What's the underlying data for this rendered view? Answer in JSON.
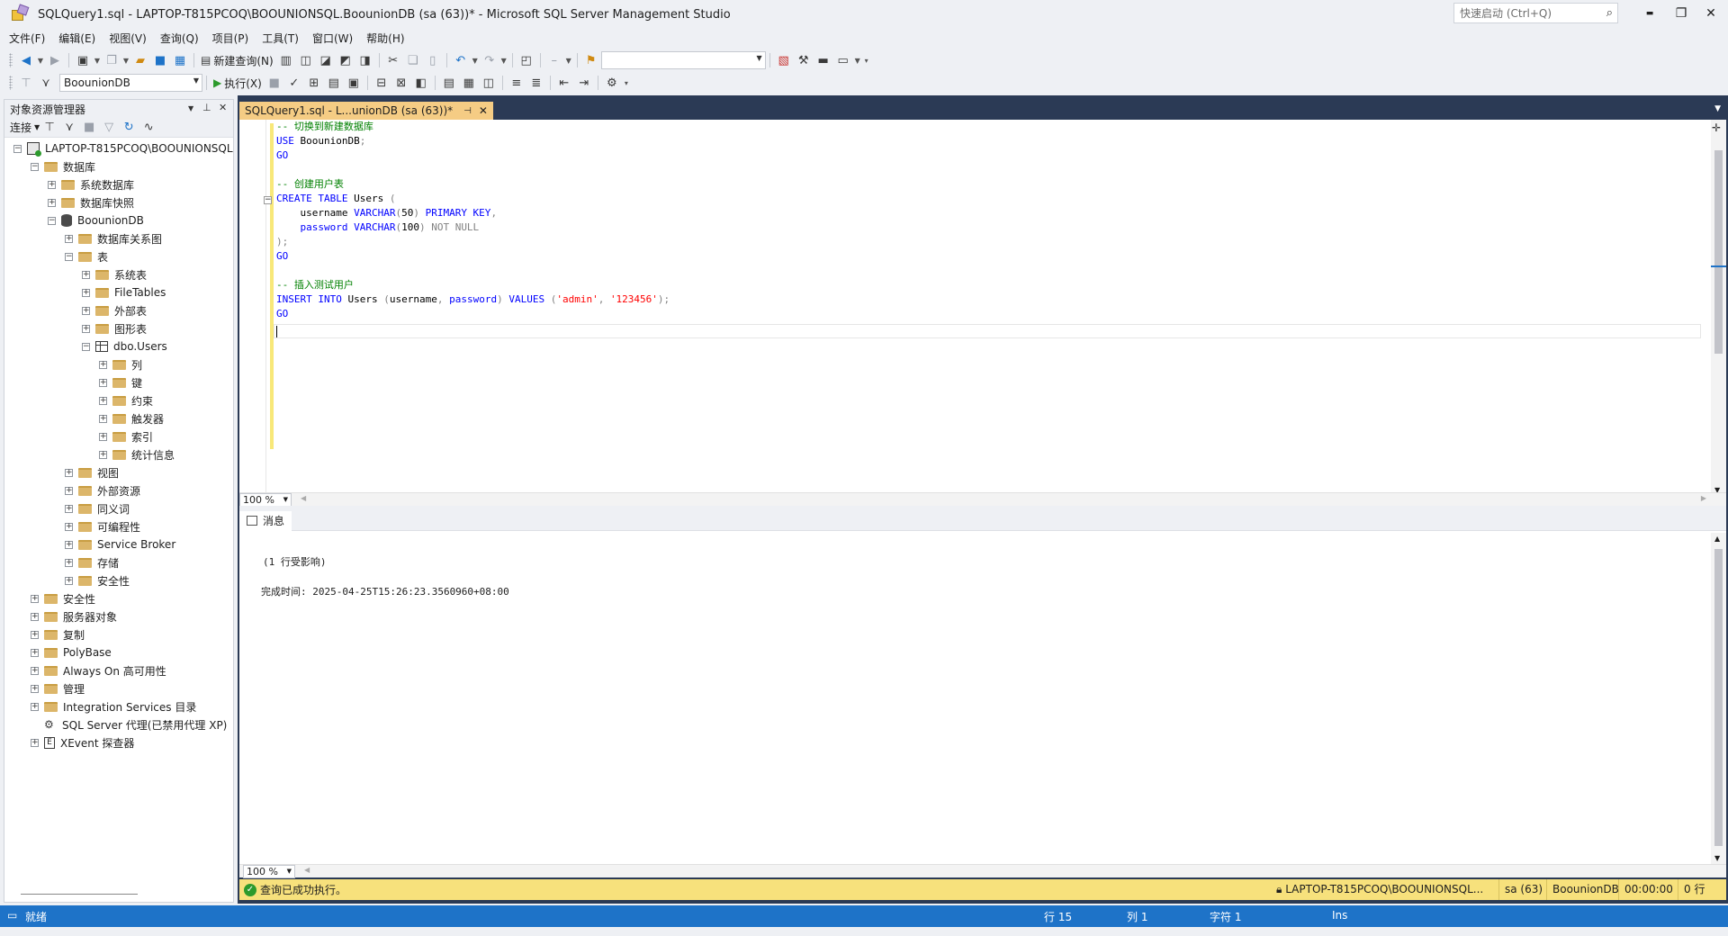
{
  "window": {
    "title": "SQLQuery1.sql - LAPTOP-T815PCOQ\\BOOUNIONSQL.BoounionDB (sa (63))* - Microsoft SQL Server Management Studio",
    "quick_launch_placeholder": "快速启动 (Ctrl+Q)",
    "minimize": "▬",
    "restore": "❐",
    "close": "✕"
  },
  "menu": [
    "文件(F)",
    "编辑(E)",
    "视图(V)",
    "查询(Q)",
    "项目(P)",
    "工具(T)",
    "窗口(W)",
    "帮助(H)"
  ],
  "toolbar": {
    "new_query_label": "新建查询(N)",
    "database_selector_value": "BoounionDB",
    "execute_label": "执行(X)",
    "solution_config_value": ""
  },
  "object_explorer": {
    "title": "对象资源管理器",
    "connect_label": "连接",
    "tree": [
      {
        "label": "LAPTOP-T815PCOQ\\BOOUNIONSQL",
        "level": 0,
        "expanded": true,
        "icon": "server"
      },
      {
        "label": "数据库",
        "level": 1,
        "expanded": true,
        "icon": "folder"
      },
      {
        "label": "系统数据库",
        "level": 2,
        "expanded": false,
        "icon": "folder"
      },
      {
        "label": "数据库快照",
        "level": 2,
        "expanded": false,
        "icon": "folder"
      },
      {
        "label": "BoounionDB",
        "level": 2,
        "expanded": true,
        "icon": "database"
      },
      {
        "label": "数据库关系图",
        "level": 3,
        "expanded": false,
        "icon": "folder"
      },
      {
        "label": "表",
        "level": 3,
        "expanded": true,
        "icon": "folder"
      },
      {
        "label": "系统表",
        "level": 4,
        "expanded": false,
        "icon": "folder"
      },
      {
        "label": "FileTables",
        "level": 4,
        "expanded": false,
        "icon": "folder"
      },
      {
        "label": "外部表",
        "level": 4,
        "expanded": false,
        "icon": "folder"
      },
      {
        "label": "图形表",
        "level": 4,
        "expanded": false,
        "icon": "folder"
      },
      {
        "label": "dbo.Users",
        "level": 4,
        "expanded": true,
        "icon": "table"
      },
      {
        "label": "列",
        "level": 5,
        "expanded": false,
        "icon": "folder"
      },
      {
        "label": "键",
        "level": 5,
        "expanded": false,
        "icon": "folder"
      },
      {
        "label": "约束",
        "level": 5,
        "expanded": false,
        "icon": "folder"
      },
      {
        "label": "触发器",
        "level": 5,
        "expanded": false,
        "icon": "folder"
      },
      {
        "label": "索引",
        "level": 5,
        "expanded": false,
        "icon": "folder"
      },
      {
        "label": "统计信息",
        "level": 5,
        "expanded": false,
        "icon": "folder"
      },
      {
        "label": "视图",
        "level": 3,
        "expanded": false,
        "icon": "folder"
      },
      {
        "label": "外部资源",
        "level": 3,
        "expanded": false,
        "icon": "folder"
      },
      {
        "label": "同义词",
        "level": 3,
        "expanded": false,
        "icon": "folder"
      },
      {
        "label": "可编程性",
        "level": 3,
        "expanded": false,
        "icon": "folder"
      },
      {
        "label": "Service Broker",
        "level": 3,
        "expanded": false,
        "icon": "folder"
      },
      {
        "label": "存储",
        "level": 3,
        "expanded": false,
        "icon": "folder"
      },
      {
        "label": "安全性",
        "level": 3,
        "expanded": false,
        "icon": "folder"
      },
      {
        "label": "安全性",
        "level": 1,
        "expanded": false,
        "icon": "folder"
      },
      {
        "label": "服务器对象",
        "level": 1,
        "expanded": false,
        "icon": "folder"
      },
      {
        "label": "复制",
        "level": 1,
        "expanded": false,
        "icon": "folder"
      },
      {
        "label": "PolyBase",
        "level": 1,
        "expanded": false,
        "icon": "folder"
      },
      {
        "label": "Always On 高可用性",
        "level": 1,
        "expanded": false,
        "icon": "folder"
      },
      {
        "label": "管理",
        "level": 1,
        "expanded": false,
        "icon": "folder"
      },
      {
        "label": "Integration Services 目录",
        "level": 1,
        "expanded": false,
        "icon": "folder"
      },
      {
        "label": "SQL Server 代理(已禁用代理 XP)",
        "level": 1,
        "expanded": null,
        "icon": "agent"
      },
      {
        "label": "XEvent 探查器",
        "level": 1,
        "expanded": false,
        "icon": "xevent"
      }
    ]
  },
  "document_tab": {
    "label": "SQLQuery1.sql - L...unionDB (sa (63))*"
  },
  "editor": {
    "lines": [
      [
        {
          "t": "-- 切换到新建数据库",
          "c": "cm"
        }
      ],
      [
        {
          "t": "USE",
          "c": "kw"
        },
        {
          "t": " BoounionDB",
          "c": "tx"
        },
        {
          "t": ";",
          "c": "gr"
        }
      ],
      [
        {
          "t": "GO",
          "c": "kw"
        }
      ],
      [],
      [
        {
          "t": "-- 创建用户表",
          "c": "cm"
        }
      ],
      [
        {
          "t": "CREATE",
          "c": "kw"
        },
        {
          "t": " ",
          "c": "tx"
        },
        {
          "t": "TABLE",
          "c": "kw"
        },
        {
          "t": " Users ",
          "c": "tx"
        },
        {
          "t": "(",
          "c": "gr"
        }
      ],
      [
        {
          "t": "    username ",
          "c": "tx"
        },
        {
          "t": "VARCHAR",
          "c": "kw"
        },
        {
          "t": "(",
          "c": "gr"
        },
        {
          "t": "50",
          "c": "tx"
        },
        {
          "t": ")",
          "c": "gr"
        },
        {
          "t": " ",
          "c": "tx"
        },
        {
          "t": "PRIMARY KEY",
          "c": "kw"
        },
        {
          "t": ",",
          "c": "gr"
        }
      ],
      [
        {
          "t": "    password ",
          "c": "kw"
        },
        {
          "t": "VARCHAR",
          "c": "kw"
        },
        {
          "t": "(",
          "c": "gr"
        },
        {
          "t": "100",
          "c": "tx"
        },
        {
          "t": ")",
          "c": "gr"
        },
        {
          "t": " NOT NULL",
          "c": "gr"
        }
      ],
      [
        {
          "t": ");",
          "c": "gr"
        }
      ],
      [
        {
          "t": "GO",
          "c": "kw"
        }
      ],
      [],
      [
        {
          "t": "-- 插入测试用户",
          "c": "cm"
        }
      ],
      [
        {
          "t": "INSERT",
          "c": "kw"
        },
        {
          "t": " ",
          "c": "tx"
        },
        {
          "t": "INTO",
          "c": "kw"
        },
        {
          "t": " Users ",
          "c": "tx"
        },
        {
          "t": "(",
          "c": "gr"
        },
        {
          "t": "username",
          "c": "tx"
        },
        {
          "t": ", ",
          "c": "gr"
        },
        {
          "t": "password",
          "c": "kw"
        },
        {
          "t": ")",
          "c": "gr"
        },
        {
          "t": " ",
          "c": "tx"
        },
        {
          "t": "VALUES",
          "c": "kw"
        },
        {
          "t": " (",
          "c": "gr"
        },
        {
          "t": "'admin'",
          "c": "st"
        },
        {
          "t": ", ",
          "c": "gr"
        },
        {
          "t": "'123456'",
          "c": "st"
        },
        {
          "t": ");",
          "c": "gr"
        }
      ],
      [
        {
          "t": "GO",
          "c": "kw"
        }
      ],
      []
    ],
    "zoom": "100 %"
  },
  "results": {
    "tab_label": "消息",
    "line1": "(1 行受影响)",
    "line2": "完成时间: 2025-04-25T15:26:23.3560960+08:00",
    "zoom": "100 %"
  },
  "query_status": {
    "message": "查询已成功执行。",
    "server": "LAPTOP-T815PCOQ\\BOOUNIONSQL...",
    "user": "sa (63)",
    "database": "BoounionDB",
    "elapsed": "00:00:00",
    "rows": "0 行"
  },
  "statusbar": {
    "ready": "就绪",
    "line": "行 15",
    "col": "列 1",
    "char": "字符 1",
    "mode": "Ins"
  }
}
